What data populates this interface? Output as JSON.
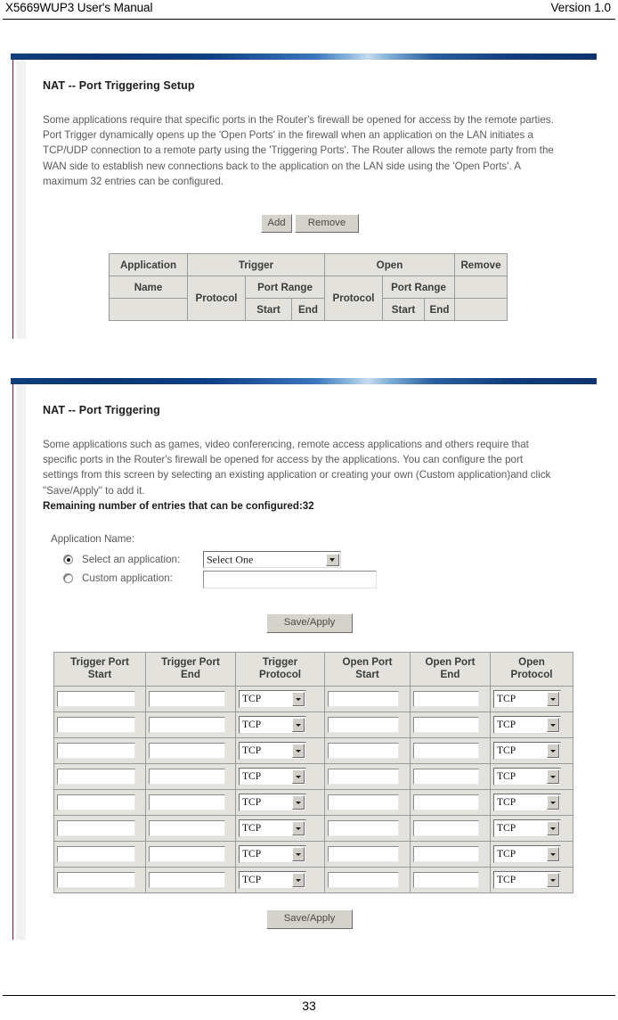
{
  "document": {
    "header_left": "X5669WUP3 User's Manual",
    "header_right": "Version 1.0",
    "page_number": "33"
  },
  "panel_setup": {
    "title": "NAT -- Port Triggering Setup",
    "description": "Some applications require that specific ports in the Router's firewall be opened for access by the remote parties. Port Trigger dynamically opens up the 'Open Ports' in the firewall when an application on the LAN initiates a TCP/UDP connection to a remote party using the 'Triggering Ports'. The Router allows the remote party from the WAN side to establish new connections back to the application on the LAN side using the 'Open Ports'. A maximum 32 entries can be configured.",
    "buttons": {
      "add": "Add",
      "remove": "Remove"
    },
    "table": {
      "row1": {
        "application": "Application",
        "trigger": "Trigger",
        "open": "Open",
        "remove": "Remove"
      },
      "row2": {
        "name": "Name",
        "trigger_protocol": "Protocol",
        "trigger_port_range": "Port Range",
        "open_protocol": "Protocol",
        "open_port_range": "Port Range"
      },
      "row3": {
        "trigger_start": "Start",
        "trigger_end": "End",
        "open_start": "Start",
        "open_end": "End"
      }
    }
  },
  "panel_triggering": {
    "title": "NAT -- Port Triggering",
    "description": "Some applications such as games, video conferencing, remote access applications and others require that specific ports in the Router's firewall be opened for access by the applications. You can configure the port settings from this screen by selecting an existing application or creating your own (Custom application)and click \"Save/Apply\" to add it.",
    "description_bold": "Remaining number of entries that can be configured:32",
    "application_name_label": "Application Name:",
    "select_application_label": "Select an application:",
    "select_application_value": "Select One",
    "select_application_selected": true,
    "custom_application_label": "Custom application:",
    "custom_application_value": "",
    "custom_application_selected": false,
    "save_apply_top": "Save/Apply",
    "save_apply_bottom": "Save/Apply",
    "grid": {
      "headers": [
        "Trigger Port Start",
        "Trigger Port End",
        "Trigger Protocol",
        "Open Port Start",
        "Open Port End",
        "Open Protocol"
      ],
      "header_lines": [
        [
          "Trigger Port",
          "Start"
        ],
        [
          "Trigger Port",
          "End"
        ],
        [
          "Trigger",
          "Protocol"
        ],
        [
          "Open Port",
          "Start"
        ],
        [
          "Open Port",
          "End"
        ],
        [
          "Open",
          "Protocol"
        ]
      ],
      "protocol_value": "TCP",
      "row_count": 8,
      "rows": [
        {
          "trigger_start": "",
          "trigger_end": "",
          "trigger_protocol": "TCP",
          "open_start": "",
          "open_end": "",
          "open_protocol": "TCP"
        },
        {
          "trigger_start": "",
          "trigger_end": "",
          "trigger_protocol": "TCP",
          "open_start": "",
          "open_end": "",
          "open_protocol": "TCP"
        },
        {
          "trigger_start": "",
          "trigger_end": "",
          "trigger_protocol": "TCP",
          "open_start": "",
          "open_end": "",
          "open_protocol": "TCP"
        },
        {
          "trigger_start": "",
          "trigger_end": "",
          "trigger_protocol": "TCP",
          "open_start": "",
          "open_end": "",
          "open_protocol": "TCP"
        },
        {
          "trigger_start": "",
          "trigger_end": "",
          "trigger_protocol": "TCP",
          "open_start": "",
          "open_end": "",
          "open_protocol": "TCP"
        },
        {
          "trigger_start": "",
          "trigger_end": "",
          "trigger_protocol": "TCP",
          "open_start": "",
          "open_end": "",
          "open_protocol": "TCP"
        },
        {
          "trigger_start": "",
          "trigger_end": "",
          "trigger_protocol": "TCP",
          "open_start": "",
          "open_end": "",
          "open_protocol": "TCP"
        },
        {
          "trigger_start": "",
          "trigger_end": "",
          "trigger_protocol": "TCP",
          "open_start": "",
          "open_end": "",
          "open_protocol": "TCP"
        }
      ]
    }
  },
  "colors": {
    "panel_bar_blue": "#123f7d",
    "panel_left_rule": "#8e1138",
    "table_header_bg": "#e4e2dd",
    "button_face": "#d5d2cb"
  }
}
